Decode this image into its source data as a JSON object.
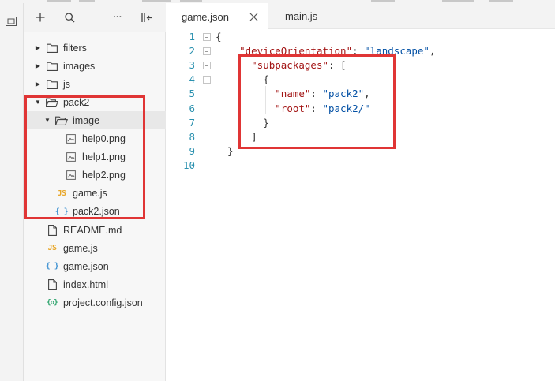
{
  "tabs": [
    {
      "label": "game.json",
      "active": true,
      "close_icon": "close-icon"
    },
    {
      "label": "main.js",
      "active": false
    }
  ],
  "explorer": {
    "toolbar": {
      "new_icon": "plus-icon",
      "search_icon": "search-icon",
      "more_label": "···",
      "collapse_icon": "collapse-panel-icon"
    },
    "tree": [
      {
        "label": "filters",
        "type": "folder",
        "expanded": false,
        "depth": 0
      },
      {
        "label": "images",
        "type": "folder",
        "expanded": false,
        "depth": 0
      },
      {
        "label": "js",
        "type": "folder",
        "expanded": false,
        "depth": 0
      },
      {
        "label": "pack2",
        "type": "folder",
        "expanded": true,
        "depth": 0
      },
      {
        "label": "image",
        "type": "folder",
        "expanded": true,
        "depth": 1,
        "selected": true
      },
      {
        "label": "help0.png",
        "type": "image",
        "depth": 2
      },
      {
        "label": "help1.png",
        "type": "image",
        "depth": 2
      },
      {
        "label": "help2.png",
        "type": "image",
        "depth": 2
      },
      {
        "label": "game.js",
        "type": "js",
        "depth": 1
      },
      {
        "label": "pack2.json",
        "type": "json",
        "depth": 1
      },
      {
        "label": "README.md",
        "type": "file",
        "depth": 0
      },
      {
        "label": "game.js",
        "type": "js",
        "depth": 0
      },
      {
        "label": "game.json",
        "type": "json",
        "depth": 0
      },
      {
        "label": "index.html",
        "type": "file",
        "depth": 0
      },
      {
        "label": "project.config.json",
        "type": "config",
        "depth": 0
      }
    ]
  },
  "icons": {
    "js": "JS",
    "json": "{ }",
    "config": "{o}"
  },
  "editor": {
    "lines": [
      {
        "n": "1",
        "fold": true,
        "tokens": [
          {
            "c": "p",
            "t": "{"
          }
        ]
      },
      {
        "n": "2",
        "fold": true,
        "tokens": [
          {
            "c": "p",
            "t": "    "
          },
          {
            "c": "k",
            "t": "\"deviceOrientation\""
          },
          {
            "c": "p",
            "t": ": "
          },
          {
            "c": "s",
            "t": "\"landscape\""
          },
          {
            "c": "p",
            "t": ","
          }
        ]
      },
      {
        "n": "3",
        "fold": true,
        "tokens": [
          {
            "c": "p",
            "t": "      "
          },
          {
            "c": "k",
            "t": "\"subpackages\""
          },
          {
            "c": "p",
            "t": ": ["
          }
        ]
      },
      {
        "n": "4",
        "fold": true,
        "tokens": [
          {
            "c": "p",
            "t": "        {"
          }
        ]
      },
      {
        "n": "5",
        "fold": false,
        "tokens": [
          {
            "c": "p",
            "t": "          "
          },
          {
            "c": "k",
            "t": "\"name\""
          },
          {
            "c": "p",
            "t": ": "
          },
          {
            "c": "s",
            "t": "\"pack2\""
          },
          {
            "c": "p",
            "t": ","
          }
        ]
      },
      {
        "n": "6",
        "fold": false,
        "tokens": [
          {
            "c": "p",
            "t": "          "
          },
          {
            "c": "k",
            "t": "\"root\""
          },
          {
            "c": "p",
            "t": ": "
          },
          {
            "c": "s",
            "t": "\"pack2/\""
          }
        ]
      },
      {
        "n": "7",
        "fold": false,
        "tokens": [
          {
            "c": "p",
            "t": "        }"
          }
        ]
      },
      {
        "n": "8",
        "fold": false,
        "tokens": [
          {
            "c": "p",
            "t": "      ]"
          }
        ]
      },
      {
        "n": "9",
        "fold": false,
        "tokens": [
          {
            "c": "p",
            "t": "  }"
          }
        ]
      },
      {
        "n": "10",
        "fold": false,
        "tokens": []
      }
    ]
  },
  "colors": {
    "highlight": "#e03535",
    "line_number": "#2b91af",
    "json_key": "#a31515",
    "json_string": "#0451a5"
  }
}
